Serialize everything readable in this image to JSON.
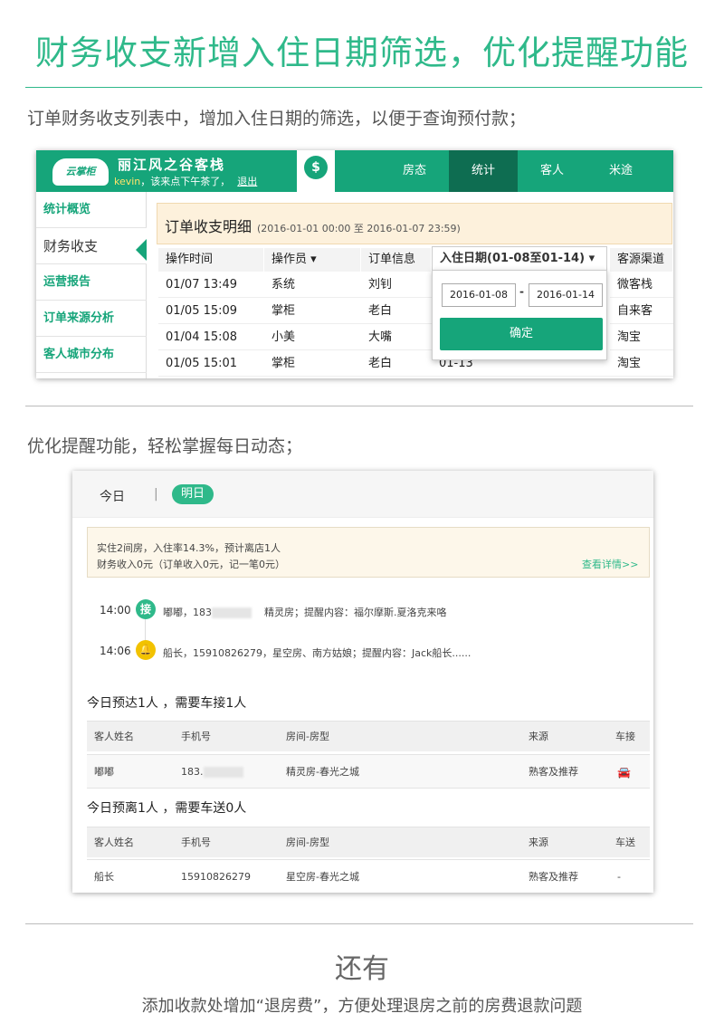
{
  "main_title": "财务收支新增入住日期筛选，优化提醒功能",
  "section1_text": "订单财务收支列表中，增加入住日期的筛选，以便于查询预付款；",
  "app1": {
    "logo": "云掌柜",
    "hotel_name": "丽江风之谷客栈",
    "greeting_user": "kevin",
    "greeting_text": "，该来点下午茶了，",
    "logout": "退出",
    "money_icon": "$",
    "nav": [
      "房态",
      "统计",
      "客人",
      "米途"
    ],
    "nav_active": "统计",
    "sidebar": [
      "统计概览",
      "财务收支",
      "运营报告",
      "订单来源分析",
      "客人城市分布"
    ],
    "sidebar_active": "财务收支",
    "panel_title": "订单收支明细",
    "panel_range": "(2016-01-01 00:00 至 2016-01-07 23:59)",
    "columns": [
      "操作时间",
      "操作员 ▾",
      "订单信息",
      "入住日期(01-08至01-14) ▾",
      "客源渠道"
    ],
    "rows": [
      [
        "01/07 13:49",
        "系统",
        "刘钊",
        "",
        "微客栈"
      ],
      [
        "01/05 15:09",
        "掌柜",
        "老白",
        "",
        "自来客"
      ],
      [
        "01/04 15:08",
        "小美",
        "大嘴",
        "",
        "淘宝"
      ],
      [
        "01/05 15:01",
        "掌柜",
        "老白",
        "01-13",
        "淘宝"
      ]
    ],
    "date_from": "2016-01-08",
    "date_sep": "-",
    "date_to": "2016-01-14",
    "confirm": "确定"
  },
  "section2_text": "优化提醒功能，轻松掌握每日动态；",
  "app2": {
    "tab_today": "今日",
    "tab_sep": "|",
    "tab_tomorrow": "明日",
    "summary_line1": "实住2间房，入住率14.3%，预计离店1人",
    "summary_line2": "财务收入0元（订单收入0元，记一笔0元）",
    "detail_link": "查看详情>>",
    "timeline": [
      {
        "time": "14:00",
        "icon": "接",
        "pre": "嘟嘟，183",
        "post": "精灵房；提醒内容：福尔摩斯.夏洛克来咯"
      },
      {
        "time": "14:06",
        "icon": "🔔",
        "pre": "船长，15910826279，星空房、南方姑娘；提醒内容：Jack船长......",
        "post": ""
      }
    ],
    "arrive_heading": "今日预达1人 ，需要车接1人",
    "arrive_cols": [
      "客人姓名",
      "手机号",
      "房间-房型",
      "来源",
      "车接"
    ],
    "arrive_row": [
      "嘟嘟",
      "183.",
      "精灵房-春光之城",
      "熟客及推荐",
      "🚘"
    ],
    "leave_heading": "今日预离1人 ，需要车送0人",
    "leave_cols": [
      "客人姓名",
      "手机号",
      "房间-房型",
      "来源",
      "车送"
    ],
    "leave_row": [
      "船长",
      "15910826279",
      "星空房-春光之城",
      "熟客及推荐",
      "-"
    ]
  },
  "also": "还有",
  "footer_text": "添加收款处增加“退房费”，方便处理退房之前的房费退款问题",
  "colors": {
    "accent": "#2fb98a",
    "nav": "#16a57a",
    "nav_active": "#0e6d51"
  }
}
